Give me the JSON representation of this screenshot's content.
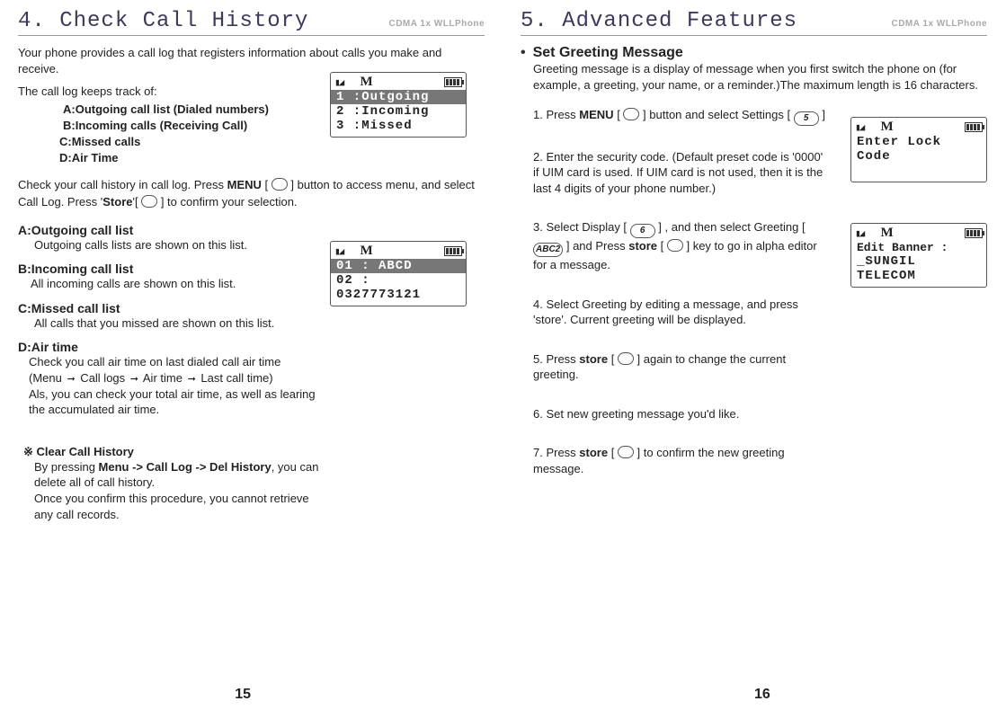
{
  "left": {
    "title": "4. Check Call History",
    "model": "CDMA 1x WLLPhone",
    "intro1": "Your phone provides a call log that registers information about calls you make and receive.",
    "intro2": "The call log keeps track of:",
    "items": {
      "a": "A:Outgoing call list (Dialed numbers)",
      "b": "B:Incoming calls (Receiving Call)",
      "c": "C:Missed calls",
      "d": "D:Air Time"
    },
    "para1a": "Check your call history in call log.  Press ",
    "para1b": "MENU",
    "para1c": " [ ",
    "para1d": " ] button to access menu, and select Call Log.  Press '",
    "para1e": "Store",
    "para1f": "'[ ",
    "para1g": " ] to confirm your selection.",
    "secA_h": "A:Outgoing call list",
    "secA_b": "Outgoing calls lists are shown on this list.",
    "secB_h": "B:Incoming call list",
    "secB_b": "All incoming calls are shown on this list.",
    "secC_h": "C:Missed call list",
    "secC_b": "All calls that you missed are shown on this list.",
    "secD_h": "D:Air time",
    "secD_b1": "Check you call air time on last dialed call air time",
    "secD_b2a": "(Menu ",
    "secD_b2b": " Call logs ",
    "secD_b2c": " Air time ",
    "secD_b2d": " Last call time)",
    "secD_b3": "Als, you can check your total air time, as well as learing the accumulated air time.",
    "note_h": "※ Clear Call History",
    "note_b1a": "By pressing ",
    "note_b1b": "Menu -> Call Log -> Del History",
    "note_b1c": ", you can delete all of call history.",
    "note_b2": "Once you confirm this procedure, you cannot retrieve any call records.",
    "lcd1": {
      "r1": "1 :Outgoing",
      "r2": "2 :Incoming",
      "r3": "3 :Missed"
    },
    "lcd2": {
      "r1": "01 : ABCD",
      "r2": "02 :",
      "r3": "0327773121"
    },
    "pagenum": "15"
  },
  "right": {
    "title": "5. Advanced Features",
    "model": "CDMA 1x WLLPhone",
    "feature_bullet": "•",
    "feature_h": "Set Greeting Message",
    "feature_intro": "Greeting message is a display of message when you first switch the phone on (for example, a greeting, your name, or a reminder.)The maximum length is 16 characters.",
    "s1a": "1. Press ",
    "s1b": "MENU",
    "s1c": " [ ",
    "s1d": " ] button and select Settings [ ",
    "s1e": " ]",
    "s1key": "5",
    "s2": "2. Enter the security code. (Default preset code is '0000' if UIM card is used.   If UIM card is not used, then it is the last 4 digits of your phone number.)",
    "s3a": "3. Select Display [ ",
    "s3b": " ] , and then select Greeting [ ",
    "s3c": " ] and Press  ",
    "s3d": "store",
    "s3e": " [ ",
    "s3f": " ] key to go in alpha editor for a message.",
    "s3key1": "6",
    "s3key2": "ABC2",
    "s4": "4. Select Greeting by editing a message, and press 'store'.  Current greeting will be displayed.",
    "s5a": "5. Press ",
    "s5b": "store",
    "s5c": " [ ",
    "s5d": " ] again to change the current greeting.",
    "s6": "6. Set new greeting message you'd like.",
    "s7a": "7. Press ",
    "s7b": "store",
    "s7c": " [ ",
    "s7d": " ] to confirm the new greeting message.",
    "lcd3": {
      "r1": "Enter Lock",
      "r2": "Code"
    },
    "lcd4": {
      "r1": "Edit Banner :",
      "r2": "_SUNGIL",
      "r3": "TELECOM"
    },
    "pagenum": "16"
  }
}
